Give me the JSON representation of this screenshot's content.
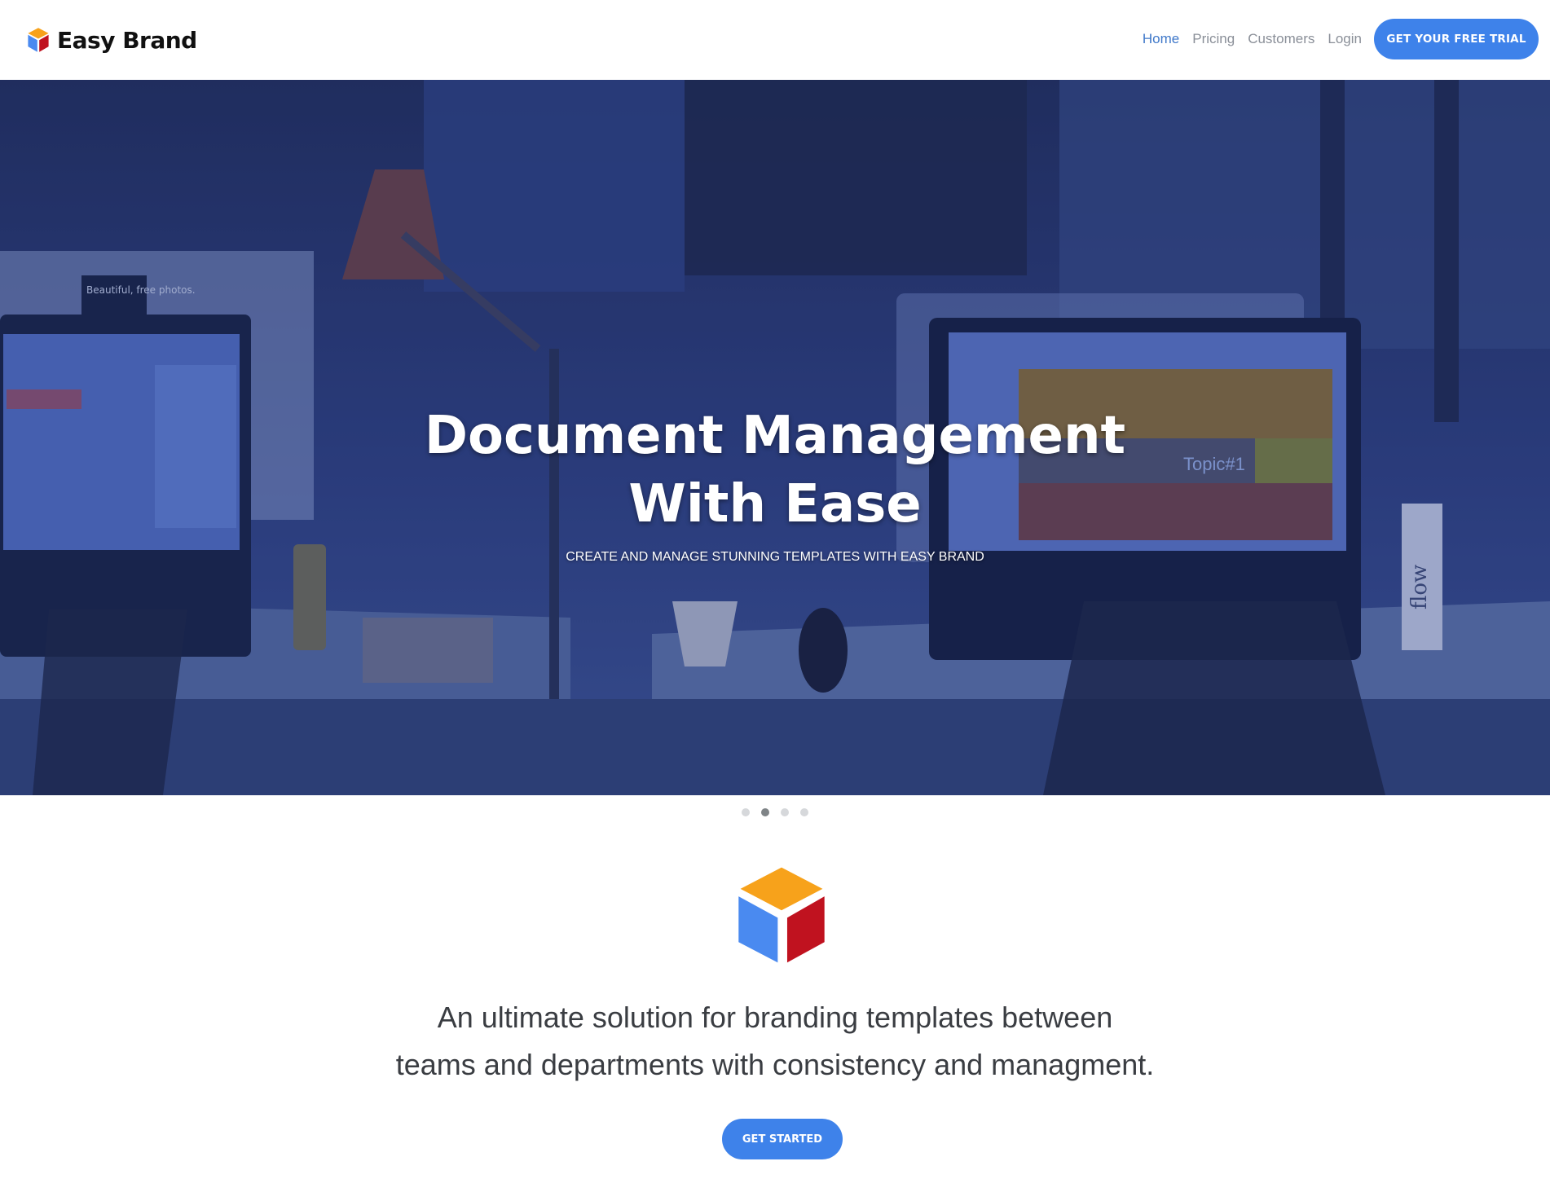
{
  "brand": {
    "name": "Easy Brand"
  },
  "nav": {
    "links": [
      {
        "label": "Home",
        "active": true
      },
      {
        "label": "Pricing",
        "active": false
      },
      {
        "label": "Customers",
        "active": false
      },
      {
        "label": "Login",
        "active": false
      }
    ],
    "cta_label": "GET YOUR FREE TRIAL"
  },
  "hero": {
    "title_line1": "Document Management",
    "title_line2": "With Ease",
    "subtitle": "CREATE AND MANAGE STUNNING TEMPLATES WITH EASY BRAND",
    "slide_count": 4,
    "active_slide": 2,
    "photo_text": {
      "sticker": "Beautiful, free photos.",
      "monitor_topic": "Topic#1",
      "bottle": "flow"
    }
  },
  "intro": {
    "tagline_line1": "An ultimate solution for branding templates between",
    "tagline_line2": "teams and departments with consistency and managment.",
    "cta_label": "GET STARTED"
  },
  "colors": {
    "accent": "#3e82ea",
    "nav_active": "#3f78c9",
    "hero_overlay": "#2a3f86",
    "cube_orange": "#f7a21b",
    "cube_blue": "#4a8af0",
    "cube_red": "#c0121f"
  },
  "icons": {
    "logo": "cube-logo-icon",
    "big_logo": "cube-logo-icon"
  }
}
